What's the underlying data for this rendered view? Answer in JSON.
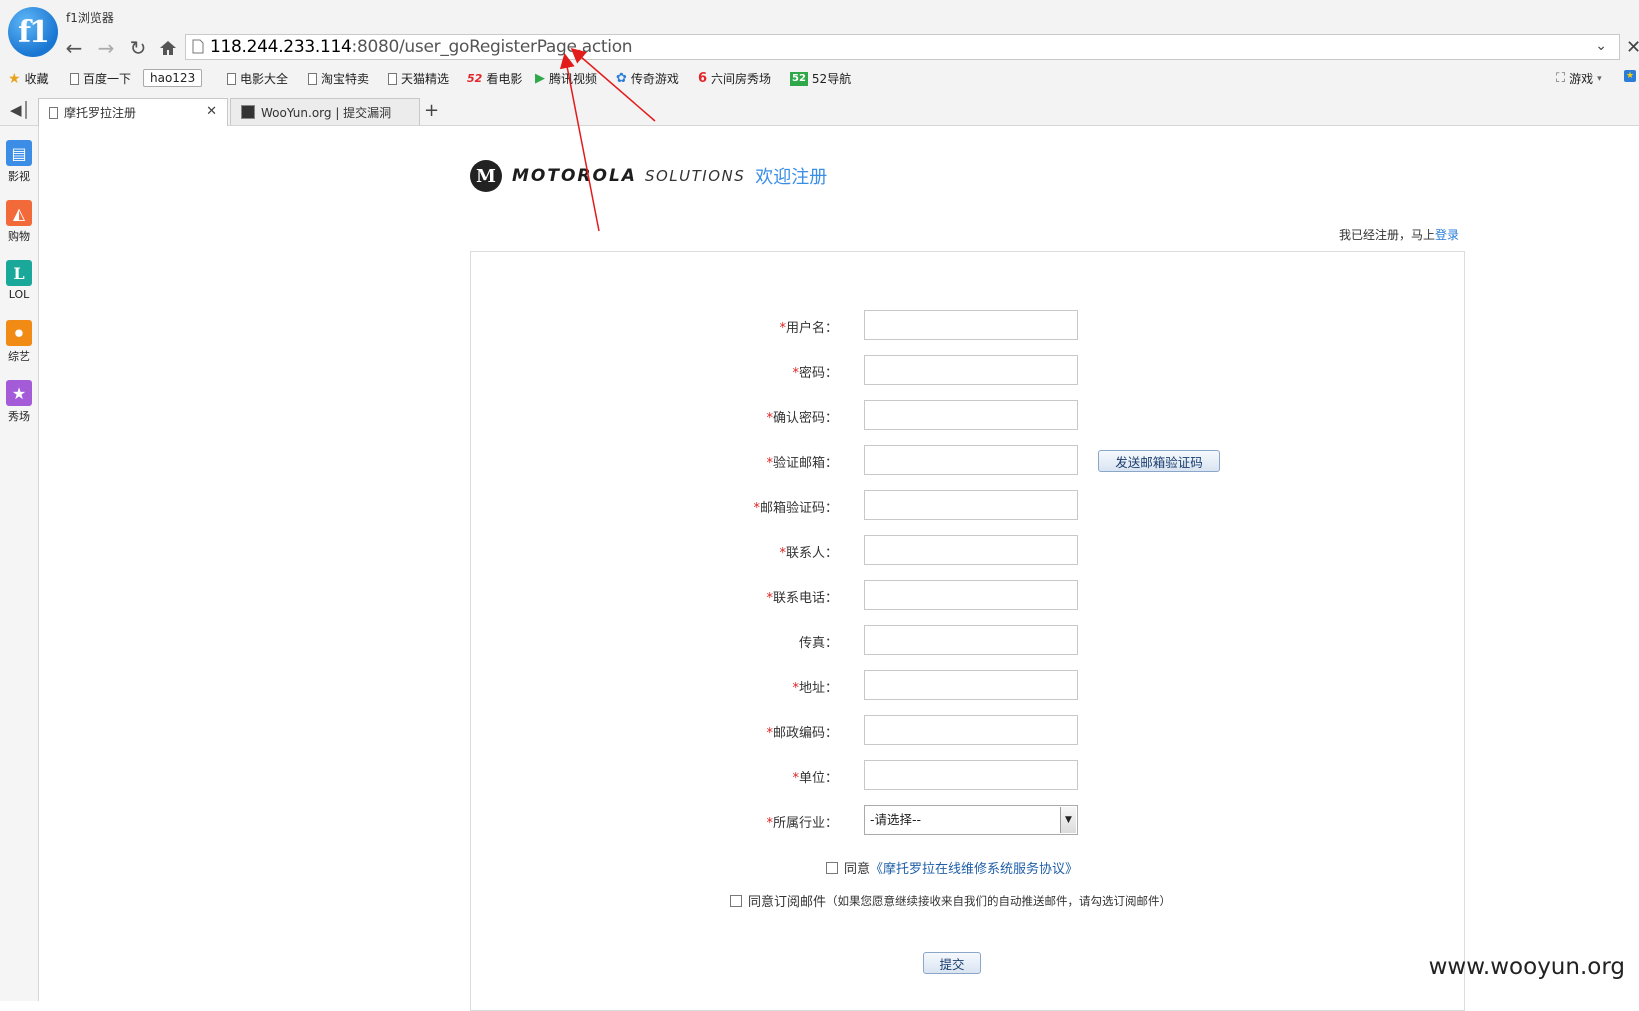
{
  "browser": {
    "name": "f1浏览器",
    "logo_text": "f1",
    "url_host": "118.244.233.114",
    "url_rest": ":8080/user_goRegisterPage.action"
  },
  "bookmarks": [
    {
      "label": "收藏"
    },
    {
      "label": "百度一下"
    },
    {
      "label": "hao123"
    },
    {
      "label": "电影大全"
    },
    {
      "label": "淘宝特卖"
    },
    {
      "label": "天猫精选"
    },
    {
      "label": "看电影",
      "badge": "52"
    },
    {
      "label": "腾讯视频"
    },
    {
      "label": "传奇游戏"
    },
    {
      "label": "六间房秀场"
    },
    {
      "label": "52导航",
      "badge": "52"
    },
    {
      "label": "游戏"
    }
  ],
  "tabs": [
    {
      "label": "摩托罗拉注册",
      "active": true
    },
    {
      "label": "WooYun.org | 提交漏洞",
      "active": false
    }
  ],
  "sidebar": [
    {
      "label": "影视",
      "color": "#3c8de6",
      "icon": "film-icon"
    },
    {
      "label": "购物",
      "color": "#f26a3a",
      "icon": "shopping-bag-icon"
    },
    {
      "label": "LOL",
      "color": "#1aa89a",
      "icon": "lol-icon",
      "glyph": "L"
    },
    {
      "label": "综艺",
      "color": "#f28a16",
      "icon": "microphone-icon"
    },
    {
      "label": "秀场",
      "color": "#a45bd8",
      "icon": "dancer-icon"
    }
  ],
  "header": {
    "logo_mark": "M",
    "brand": "MOTOROLA",
    "solutions": "SOLUTIONS",
    "welcome": "欢迎注册"
  },
  "login_hint": {
    "text": "我已经注册，马上",
    "link": "登录"
  },
  "form": {
    "fields": [
      {
        "label": "用户名：",
        "required": true
      },
      {
        "label": "密码：",
        "required": true
      },
      {
        "label": "确认密码：",
        "required": true
      },
      {
        "label": "验证邮箱：",
        "required": true
      },
      {
        "label": "邮箱验证码：",
        "required": true
      },
      {
        "label": "联系人：",
        "required": true
      },
      {
        "label": "联系电话：",
        "required": true
      },
      {
        "label": "传真：",
        "required": false
      },
      {
        "label": "地址：",
        "required": true
      },
      {
        "label": "邮政编码：",
        "required": true
      },
      {
        "label": "单位：",
        "required": true
      },
      {
        "label": "所属行业：",
        "required": true
      }
    ],
    "required_mark": "*",
    "send_code_label": "发送邮箱验证码",
    "industry_selected": "-请选择--",
    "agree_prefix": "同意",
    "agree_link": "《摩托罗拉在线维修系统服务协议》",
    "subscribe_label": "同意订阅邮件",
    "subscribe_note": "（如果您愿意继续接收来自我们的自动推送邮件，请勾选订阅邮件）",
    "submit_label": "提交"
  },
  "watermark": "www.wooyun.org",
  "colors": {
    "accent": "#3a8ee6",
    "required": "#e02020",
    "annotation_arrow": "#e21b1b"
  }
}
